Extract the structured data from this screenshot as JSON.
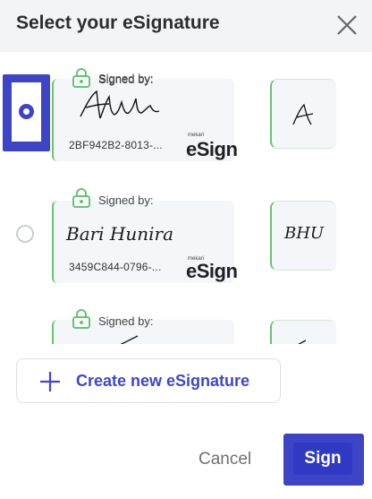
{
  "dialog": {
    "title": "Select your eSignature",
    "close_icon": "close-icon"
  },
  "signatures": [
    {
      "selected": true,
      "signed_by_label": "Signed by:",
      "signature_text": "Abode",
      "hash": "2BF942B2-8013-...",
      "brand_small": "mekari",
      "brand": "eSign",
      "initials_text": "A"
    },
    {
      "selected": false,
      "signed_by_label": "Signed by:",
      "signature_text": "Bari Hunira",
      "hash": "3459C844-0796-...",
      "brand_small": "mekari",
      "brand": "eSign",
      "initials_text": "BHU"
    },
    {
      "selected": false,
      "signed_by_label": "Signed by:"
    }
  ],
  "actions": {
    "create_label": "Create new eSignature",
    "cancel_label": "Cancel",
    "sign_label": "Sign"
  },
  "colors": {
    "accent": "#3d44c6",
    "success_border": "#67c473",
    "header_bg": "#f3f4f6"
  }
}
